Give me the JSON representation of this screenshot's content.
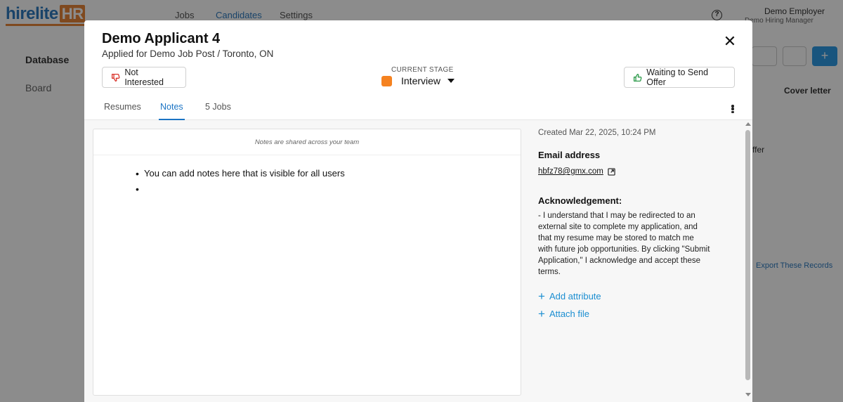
{
  "background": {
    "logo_hire": "hirelite",
    "logo_hr": "HR",
    "nav": [
      "Jobs",
      "Candidates",
      "Settings"
    ],
    "help_icon_glyph": "?",
    "employer_name": "Demo Employer",
    "employer_role": "Demo Hiring Manager",
    "sidebar": [
      "Database",
      "Board"
    ],
    "cover_letter": "Cover letter",
    "offer_fragment": "ffer",
    "export_label": "Export These Records",
    "add_glyph": "+"
  },
  "modal": {
    "applicant_name": "Demo Applicant 4",
    "applied_for": "Applied for Demo Job Post / Toronto, ON",
    "close_glyph": "✕",
    "not_interested_label": "Not Interested",
    "current_stage_caption": "CURRENT STAGE",
    "stage_label": "Interview",
    "stage_color": "#f58220",
    "waiting_offer_label": "Waiting to Send Offer",
    "tabs": [
      {
        "label": "Resumes",
        "active": false
      },
      {
        "label": "Notes",
        "active": true
      },
      {
        "label": "5 Jobs",
        "active": false
      }
    ],
    "notes": {
      "shared_caption": "Notes are shared across your team",
      "items": [
        "You can add notes here that is visible for all users",
        ""
      ]
    },
    "details": {
      "created": "Created Mar 22, 2025, 10:24 PM",
      "email_heading": "Email address",
      "email_value": "hbfz78@gmx.com",
      "ack_heading": "Acknowledgement:",
      "ack_text": "- I understand that I may be redirected to an external site to complete my application, and that my resume may be stored to match me with future job opportunities. By clicking \"Submit Application,\" I acknowledge and accept these terms.",
      "add_attribute_label": "Add attribute",
      "attach_file_label": "Attach file"
    }
  },
  "colors": {
    "accent": "#1b74c4",
    "link": "#1b8ed1",
    "brand_orange": "#e8863a"
  },
  "icons": {
    "not_interested": "thumbs-down-icon",
    "waiting_offer": "thumbs-up-icon",
    "email_external": "external-link-icon",
    "more": "kebab-menu-icon",
    "close": "close-icon"
  }
}
